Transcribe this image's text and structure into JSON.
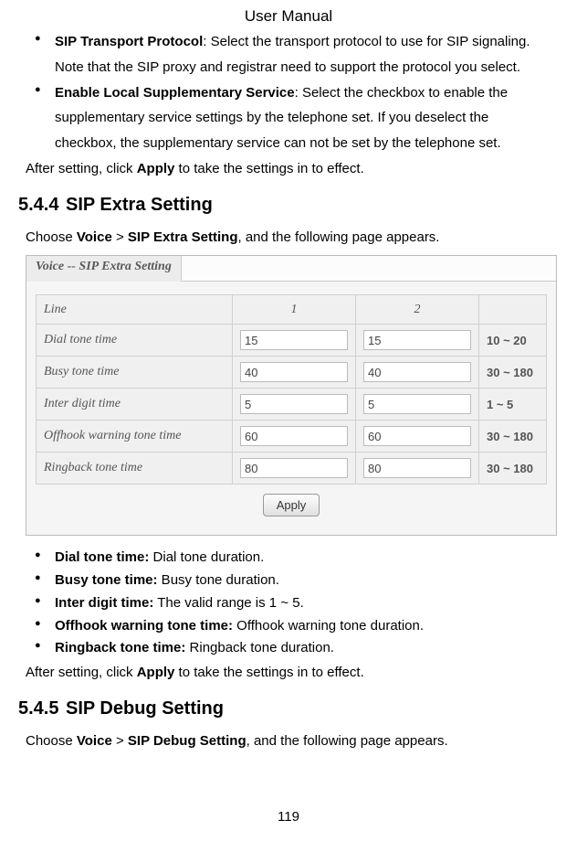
{
  "header": {
    "title": "User Manual"
  },
  "intro_bullets": [
    {
      "bold": "SIP Transport Protocol",
      "sep": ": ",
      "text": "Select the transport protocol to use for SIP signaling. Note that the SIP proxy and registrar need to support the protocol you select."
    },
    {
      "bold": "Enable Local Supplementary Service",
      "sep": ": ",
      "text": "Select the checkbox to enable the supplementary service settings by the telephone set. If you deselect the checkbox, the supplementary service can not be set by the telephone set."
    }
  ],
  "after_setting": {
    "prefix": "After setting, click ",
    "bold": "Apply",
    "suffix": " to take the settings in to effect."
  },
  "section1": {
    "num": "5.4.4",
    "title": "SIP Extra Setting",
    "choose": {
      "pre": "Choose ",
      "b1": "Voice",
      "mid": " > ",
      "b2": "SIP Extra Setting",
      "post": ", and the following page appears."
    }
  },
  "screenshot": {
    "tab_label": "Voice -- SIP Extra Setting",
    "line_header": "Line",
    "col1": "1",
    "col2": "2",
    "rows": [
      {
        "label": "Dial tone time",
        "v1": "15",
        "v2": "15",
        "range": "10 ~ 20"
      },
      {
        "label": "Busy tone time",
        "v1": "40",
        "v2": "40",
        "range": "30 ~ 180"
      },
      {
        "label": "Inter digit time",
        "v1": "5",
        "v2": "5",
        "range": "1 ~ 5"
      },
      {
        "label": "Offhook warning tone time",
        "v1": "60",
        "v2": "60",
        "range": "30 ~ 180"
      },
      {
        "label": "Ringback tone time",
        "v1": "80",
        "v2": "80",
        "range": "30 ~ 180"
      }
    ],
    "apply_label": "Apply"
  },
  "desc_bullets": [
    {
      "bold": "Dial tone time:",
      "text": " Dial tone duration."
    },
    {
      "bold": "Busy tone time:",
      "text": " Busy tone duration."
    },
    {
      "bold": "Inter digit time:",
      "text": " The valid range is 1 ~ 5."
    },
    {
      "bold": "Offhook warning tone time:",
      "text": " Offhook warning tone duration."
    },
    {
      "bold": "Ringback tone time:",
      "text": " Ringback tone duration."
    }
  ],
  "section2": {
    "num": "5.4.5",
    "title": "SIP Debug Setting",
    "choose": {
      "pre": "Choose ",
      "b1": "Voice",
      "mid": " > ",
      "b2": "SIP Debug Setting",
      "post": ", and the following page appears."
    }
  },
  "page_number": "119"
}
